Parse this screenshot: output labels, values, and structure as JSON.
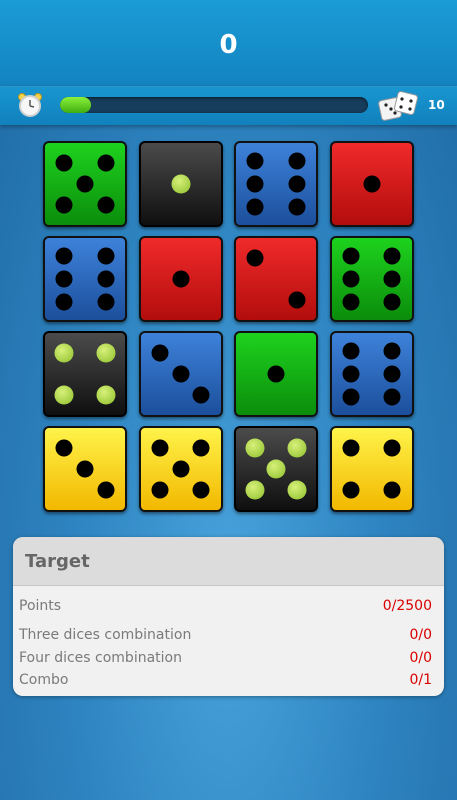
{
  "header": {
    "score": "0"
  },
  "status": {
    "clock_icon": "alarm-clock-icon",
    "progress": 0.1,
    "dice_icon": "dice-icon",
    "dice_count": "10",
    "colors": {
      "progress_fill": "#5fd21f",
      "track": "#173d5c"
    }
  },
  "board": {
    "rows": [
      [
        {
          "color": "green",
          "value": 5
        },
        {
          "color": "black",
          "value": 1
        },
        {
          "color": "blue",
          "value": 6
        },
        {
          "color": "red",
          "value": 1
        }
      ],
      [
        {
          "color": "blue",
          "value": 6
        },
        {
          "color": "red",
          "value": 1
        },
        {
          "color": "red",
          "value": 2
        },
        {
          "color": "green",
          "value": 6
        }
      ],
      [
        {
          "color": "black",
          "value": 4
        },
        {
          "color": "blue",
          "value": 3
        },
        {
          "color": "green",
          "value": 1
        },
        {
          "color": "blue",
          "value": 6
        }
      ],
      [
        {
          "color": "yellow",
          "value": 3
        },
        {
          "color": "yellow",
          "value": 5
        },
        {
          "color": "black",
          "value": 5
        },
        {
          "color": "yellow",
          "value": 4
        }
      ]
    ]
  },
  "target": {
    "title": "Target",
    "rows": [
      {
        "label": "Points",
        "value": "0/2500"
      },
      {
        "label": "Three dices combination",
        "value": "0/0"
      },
      {
        "label": "Four dices combination",
        "value": "0/0"
      },
      {
        "label": "Combo",
        "value": "0/1"
      }
    ]
  }
}
